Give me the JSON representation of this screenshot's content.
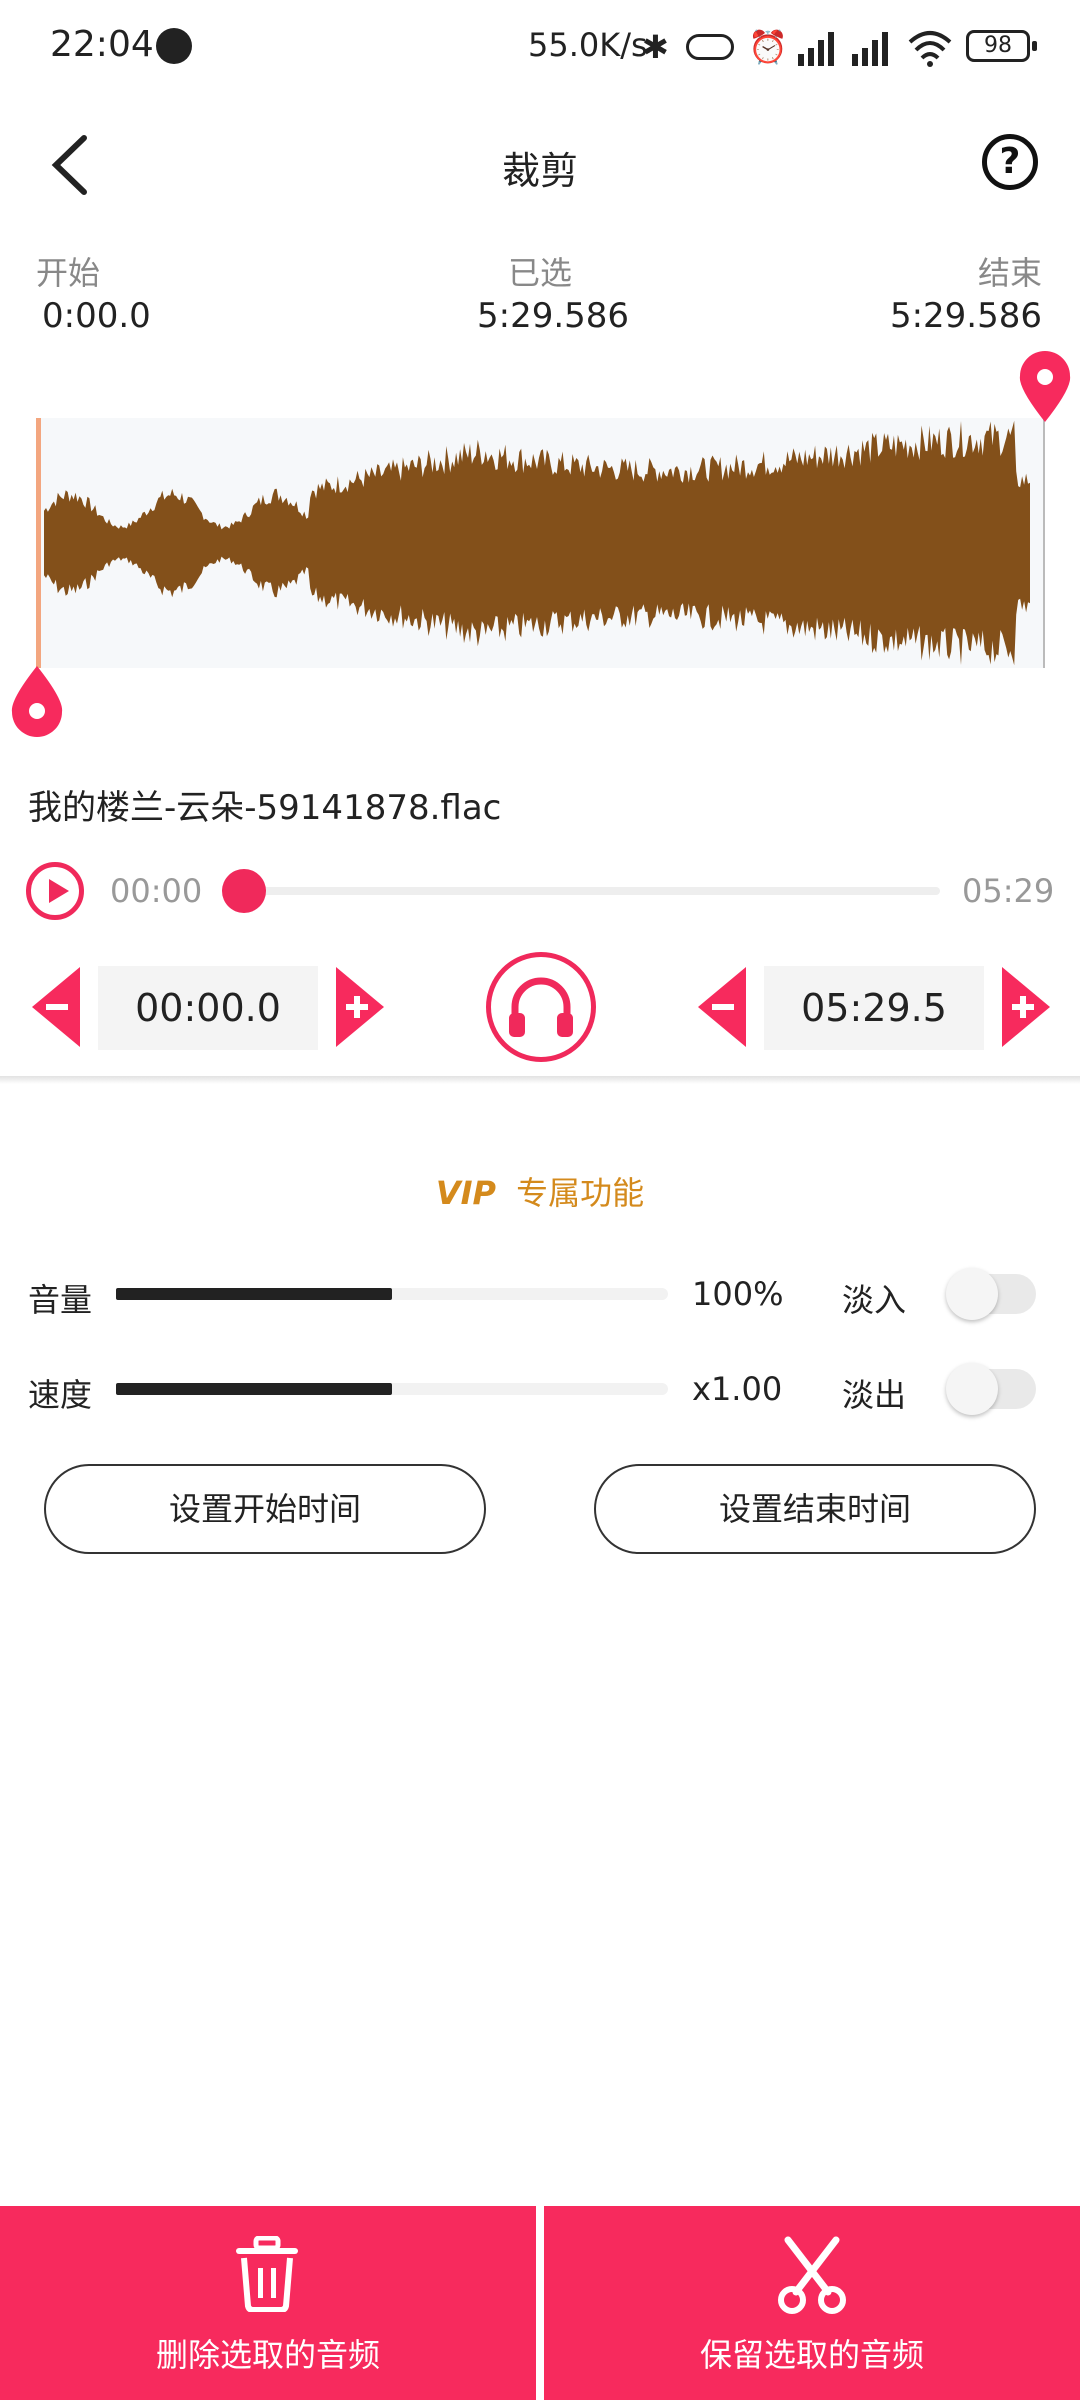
{
  "status_bar": {
    "time": "22:04",
    "net_speed": "55.0K/s",
    "battery": "98"
  },
  "header": {
    "title": "裁剪"
  },
  "times": {
    "start_label": "开始",
    "start_value": "0:00.0",
    "selected_label": "已选",
    "selected_value": "5:29.586",
    "end_label": "结束",
    "end_value": "5:29.586"
  },
  "file": {
    "name": "我的楼兰-云朵-59141878.flac"
  },
  "playback": {
    "current": "00:00",
    "total": "05:29",
    "progress": 0
  },
  "stepper": {
    "start": "00:00.0",
    "end": "05:29.5"
  },
  "vip": {
    "logo": "VIP",
    "label": "专属功能"
  },
  "controls": {
    "volume_label": "音量",
    "volume_value": "100%",
    "volume_fraction": 0.5,
    "speed_label": "速度",
    "speed_value": "x1.00",
    "speed_fraction": 0.5,
    "fade_in_label": "淡入",
    "fade_out_label": "淡出",
    "fade_in_on": false,
    "fade_out_on": false
  },
  "buttons": {
    "set_start": "设置开始时间",
    "set_end": "设置结束时间"
  },
  "bottom": {
    "delete_label": "删除选取的音频",
    "keep_label": "保留选取的音频"
  },
  "colors": {
    "accent": "#f72a5d",
    "waveform": "#83501a",
    "vip": "#d48a1c"
  }
}
